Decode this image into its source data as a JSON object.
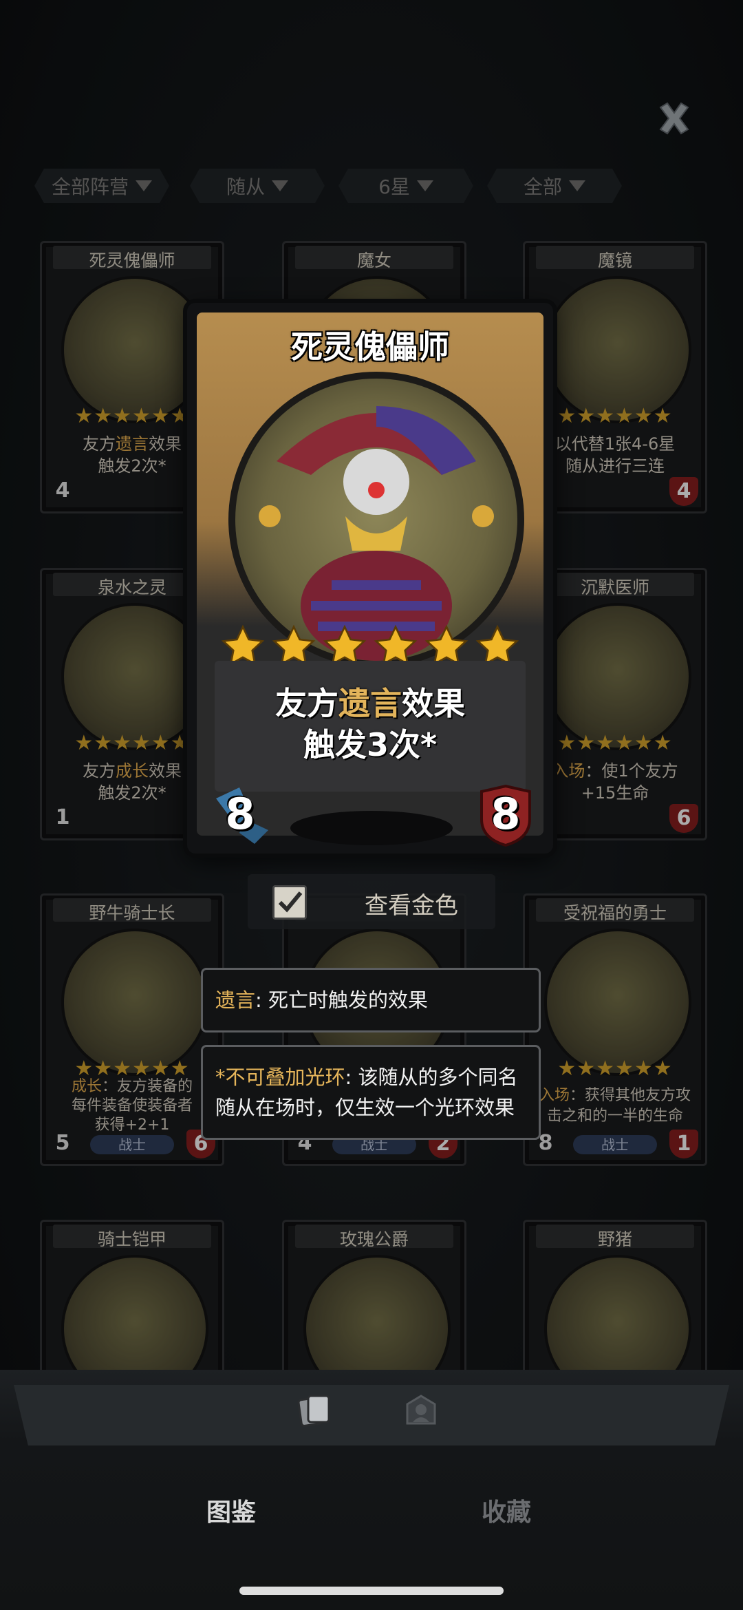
{
  "filters": [
    {
      "label": "全部阵营"
    },
    {
      "label": "随从"
    },
    {
      "label": "6星"
    },
    {
      "label": "全部"
    }
  ],
  "cards": [
    {
      "name": "死灵傀儡师",
      "desc_pre": "友方",
      "desc_hl": "遗言",
      "desc_post": "效果",
      "desc_line2": "触发2次*",
      "attack": "4",
      "health": "",
      "tribe": "",
      "stars": 6
    },
    {
      "name": "魔女",
      "desc_pre": "",
      "desc_hl": "",
      "desc_post": "",
      "desc_line2": "",
      "attack": "",
      "health": "",
      "tribe": "",
      "stars": 6
    },
    {
      "name": "魔镜",
      "desc_pre": "以代替1张4-6星",
      "desc_hl": "",
      "desc_post": "",
      "desc_line2": "随从进行三连",
      "attack": "",
      "health": "4",
      "tribe": "",
      "stars": 6
    },
    {
      "name": "泉水之灵",
      "desc_pre": "友方",
      "desc_hl": "成长",
      "desc_post": "效果",
      "desc_line2": "触发2次*",
      "attack": "1",
      "health": "",
      "tribe": "",
      "stars": 6
    },
    {
      "name": "沉默医师",
      "desc_pre": "",
      "desc_hl": "入场",
      "desc_post": "：使1个友方",
      "desc_line2": "+15生命",
      "attack": "",
      "health": "6",
      "tribe": "",
      "stars": 6
    },
    {
      "name": "野牛骑士长",
      "desc_pre": "",
      "desc_hl": "成长",
      "desc_post": "：友方装备的",
      "desc_line2": "每件装备使装备者",
      "desc_line3": "获得+2+1",
      "attack": "5",
      "health": "6",
      "tribe": "战士",
      "stars": 6
    },
    {
      "name": "",
      "desc_pre": "",
      "desc_hl": "",
      "desc_post": "",
      "desc_line2": "",
      "attack": "4",
      "health": "2",
      "tribe": "战士",
      "stars": 6
    },
    {
      "name": "受祝福的勇士",
      "desc_pre": "",
      "desc_hl": "入场",
      "desc_post": "：获得其他友方攻",
      "desc_line2": "击之和的一半的生命",
      "attack": "8",
      "health": "1",
      "tribe": "战士",
      "stars": 6
    },
    {
      "name": "骑士铠甲",
      "desc_pre": "",
      "desc_hl": "",
      "desc_post": "",
      "desc_line2": "",
      "attack": "",
      "health": "",
      "tribe": "",
      "stars": 0
    },
    {
      "name": "玫瑰公爵",
      "desc_pre": "",
      "desc_hl": "",
      "desc_post": "",
      "desc_line2": "",
      "attack": "",
      "health": "",
      "tribe": "",
      "stars": 0
    },
    {
      "name": "野猪",
      "desc_pre": "",
      "desc_hl": "",
      "desc_post": "",
      "desc_line2": "",
      "attack": "",
      "health": "",
      "tribe": "",
      "stars": 0
    }
  ],
  "featured": {
    "name": "死灵傀儡师",
    "desc_pre": "友方",
    "desc_hl": "遗言",
    "desc_post": "效果",
    "desc_line2": "触发3次*",
    "attack": "8",
    "health": "8",
    "stars": 6
  },
  "gold_toggle": {
    "label": "查看金色",
    "checked": true
  },
  "tooltips": [
    {
      "keyword": "遗言",
      "text": ": 死亡时触发的效果"
    },
    {
      "keyword": "*不可叠加光环",
      "text": ": 该随从的多个同名随从在场时，仅生效一个光环效果"
    }
  ],
  "bottom_nav": [
    {
      "label": "图鉴",
      "active": true
    },
    {
      "label": "收藏",
      "active": false
    }
  ],
  "colors": {
    "highlight": "#e3b45b",
    "attack_blue": "#2d5f86",
    "health_red": "#7e1d1d",
    "star_gold": "#f0b728"
  },
  "icons": [
    "close-icon",
    "filter-dropdown-icon",
    "star-icon",
    "checkbox-check-icon",
    "cards-tab-icon",
    "hero-tab-icon"
  ]
}
